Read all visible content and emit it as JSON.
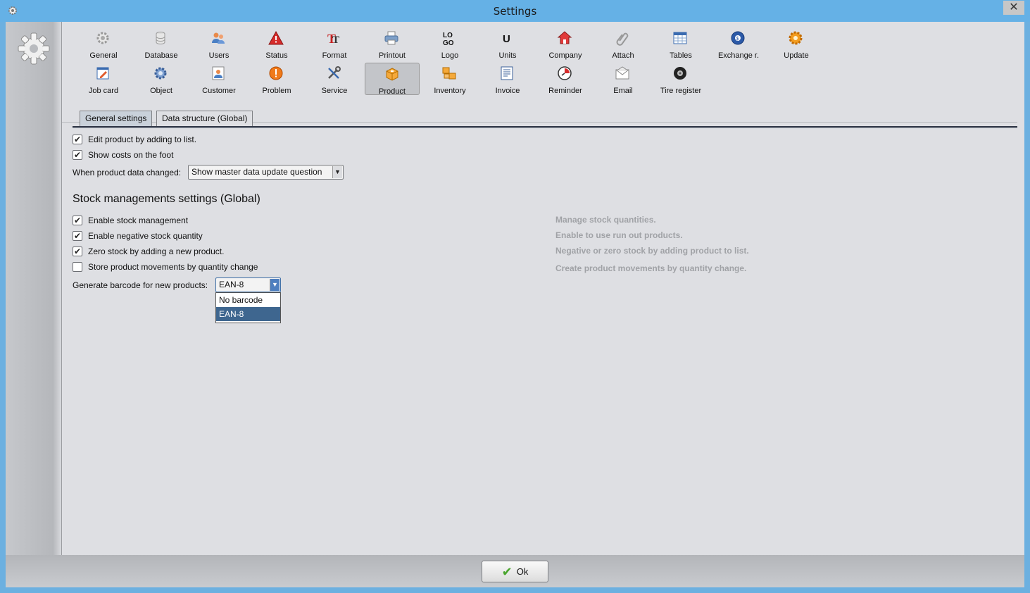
{
  "window": {
    "title": "Settings",
    "close_glyph": "✕"
  },
  "toolbar": {
    "row1": [
      {
        "label": "General",
        "icon": "gear-icon"
      },
      {
        "label": "Database",
        "icon": "database-icon"
      },
      {
        "label": "Users",
        "icon": "users-icon"
      },
      {
        "label": "Status",
        "icon": "warning-icon"
      },
      {
        "label": "Format",
        "icon": "format-icon"
      },
      {
        "label": "Printout",
        "icon": "printer-icon"
      },
      {
        "label": "Logo",
        "icon": "logo-icon"
      },
      {
        "label": "Units",
        "icon": "units-icon"
      },
      {
        "label": "Company",
        "icon": "house-icon"
      },
      {
        "label": "Attach",
        "icon": "paperclip-icon"
      },
      {
        "label": "Tables",
        "icon": "table-icon"
      },
      {
        "label": "Exchange r.",
        "icon": "currency-icon"
      },
      {
        "label": "Update",
        "icon": "update-icon"
      }
    ],
    "row2": [
      {
        "label": "Job card",
        "icon": "job-card-icon"
      },
      {
        "label": "Object",
        "icon": "object-gear-icon"
      },
      {
        "label": "Customer",
        "icon": "customer-icon"
      },
      {
        "label": "Problem",
        "icon": "problem-icon"
      },
      {
        "label": "Service",
        "icon": "tools-icon"
      },
      {
        "label": "Product",
        "icon": "box-icon"
      },
      {
        "label": "Inventory",
        "icon": "inventory-icon"
      },
      {
        "label": "Invoice",
        "icon": "invoice-icon"
      },
      {
        "label": "Reminder",
        "icon": "reminder-icon"
      },
      {
        "label": "Email",
        "icon": "email-icon"
      },
      {
        "label": "Tire register",
        "icon": "tire-icon"
      }
    ],
    "logo_text": "LO GO",
    "units_text": "U"
  },
  "tabs": {
    "general": "General settings",
    "structure": "Data structure (Global)"
  },
  "general": {
    "edit_by_adding": "Edit product by adding to list.",
    "show_costs": "Show costs on the foot",
    "data_changed_label": "When product data changed:",
    "data_changed_value": "Show master data update question"
  },
  "stock": {
    "title": "Stock managements settings (Global)",
    "enable": "Enable stock management",
    "negative": "Enable negative stock quantity",
    "zero_stock": "Zero stock by adding a new product.",
    "store_movements": "Store product movements by quantity change",
    "barcode_label": "Generate barcode for new products:",
    "barcode_value": "EAN-8",
    "barcode_options": [
      "No barcode",
      "EAN-8"
    ]
  },
  "hints": {
    "manage": "Manage stock quantities.",
    "runout": "Enable to use run out products.",
    "negative_zero": "Negative or zero stock by adding product to list.",
    "movements": "Create product movements by quantity change."
  },
  "footer": {
    "ok_label": "Ok"
  },
  "colors": {
    "accent": "#65b1e6",
    "selected": "#3e668f"
  }
}
